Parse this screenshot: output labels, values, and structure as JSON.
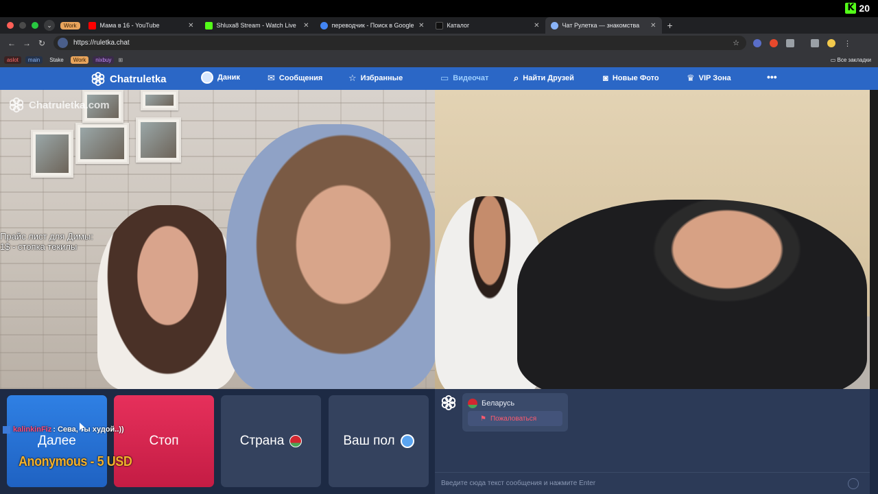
{
  "stream_overlay": {
    "kick_viewers": "20",
    "kick_logo": "K",
    "chat_user": "kalinkinFiz",
    "chat_message": ": Сева, ты худой..))",
    "donation": "Anonymous - 5 USD",
    "video_text_line1": "Прайс лист для Димы:",
    "video_text_line2": "1$ - стопка текилы"
  },
  "browser": {
    "tab_group_label": "Work",
    "tabs": [
      {
        "title": "Мама в 16 - YouTube",
        "favicon_color": "#ff0000"
      },
      {
        "title": "Shluxa8 Stream - Watch Live",
        "favicon_color": "#53fc18"
      },
      {
        "title": "переводчик - Поиск в Google",
        "favicon_color": "#4285f4"
      },
      {
        "title": "Каталог",
        "favicon_color": "#222222"
      },
      {
        "title": "Чат Рулетка — знакомства",
        "favicon_color": "#8ab4f8"
      }
    ],
    "url": "https://ruletka.chat",
    "bookmarks": [
      "aslot",
      "main",
      "Stake",
      "Work",
      "nixbuy"
    ],
    "all_bookmarks": "Все закладки"
  },
  "site": {
    "logo": "Chatruletka",
    "user_name": "Даник",
    "nav": [
      {
        "label": "Сообщения",
        "icon": "envelope-icon"
      },
      {
        "label": "Избранные",
        "icon": "star-icon"
      },
      {
        "label": "Видеочат",
        "icon": "camera-icon"
      },
      {
        "label": "Найти Друзей",
        "icon": "search-icon"
      },
      {
        "label": "Новые Фото",
        "icon": "photo-camera-icon"
      },
      {
        "label": "VIP Зона",
        "icon": "crown-icon"
      }
    ],
    "more": "•••",
    "watermark": "Chatruletka.com"
  },
  "controls": {
    "next": "Далее",
    "stop": "Стоп",
    "country": "Страна",
    "gender": "Ваш пол"
  },
  "chat": {
    "country": "Беларусь",
    "report": "Пожаловаться",
    "input_placeholder": "Введите сюда текст сообщения и нажмите Enter"
  }
}
